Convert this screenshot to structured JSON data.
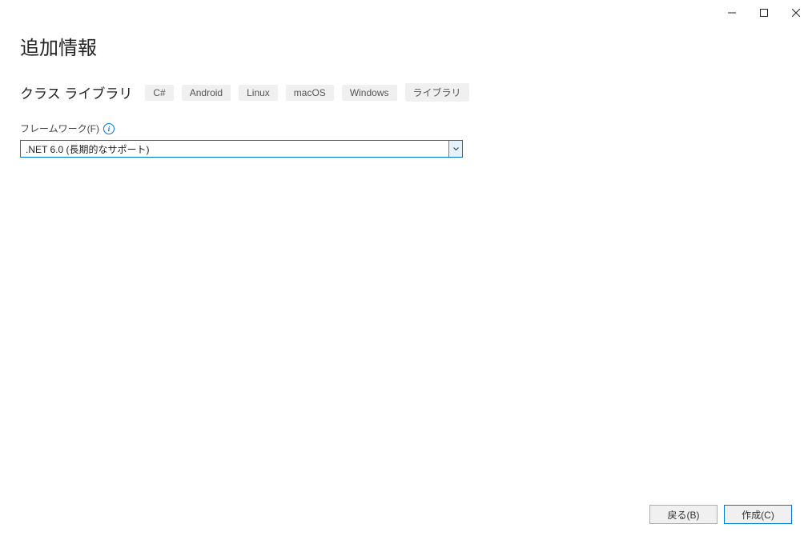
{
  "header": {
    "page_title": "追加情報",
    "subtitle": "クラス ライブラリ",
    "tags": [
      "C#",
      "Android",
      "Linux",
      "macOS",
      "Windows",
      "ライブラリ"
    ]
  },
  "framework": {
    "label": "フレームワーク(F)",
    "selected": ".NET 6.0 (長期的なサポート)"
  },
  "footer": {
    "back_label": "戻る(B)",
    "create_label": "作成(C)"
  }
}
